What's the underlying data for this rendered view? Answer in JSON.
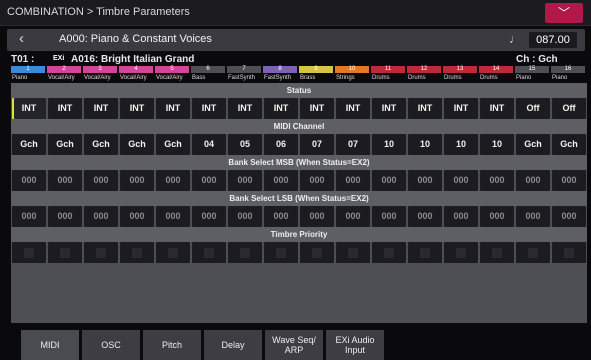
{
  "title": "COMBINATION > Timbre Parameters",
  "menu_icon": "chevron-down-icon",
  "header": {
    "back_icon": "back-chevron-icon",
    "name": "A000: Piano & Constant Voices",
    "tempo_icon": "quarter-note-icon",
    "tempo": "087.00"
  },
  "timbre_info": {
    "timbre": "T01 :",
    "exi": "EXi",
    "program": "A016: Bright Italian Grand",
    "channel": "Ch : Gch"
  },
  "timbres": [
    {
      "num": "1",
      "color": "#3a8ad8",
      "name": "Piano"
    },
    {
      "num": "2",
      "color": "#d3459a",
      "name": "Vocal/Airy"
    },
    {
      "num": "3",
      "color": "#d3459a",
      "name": "Vocal/Airy"
    },
    {
      "num": "4",
      "color": "#d3459a",
      "name": "Vocal/Airy"
    },
    {
      "num": "5",
      "color": "#d3459a",
      "name": "Vocal/Airy"
    },
    {
      "num": "6",
      "color": "#4e4f54",
      "name": "Bass"
    },
    {
      "num": "7",
      "color": "#4e4f54",
      "name": "FastSynth"
    },
    {
      "num": "8",
      "color": "#7d62b0",
      "name": "FastSynth"
    },
    {
      "num": "9",
      "color": "#d8c440",
      "name": "Brass"
    },
    {
      "num": "10",
      "color": "#e07a2a",
      "name": "Strings"
    },
    {
      "num": "11",
      "color": "#c1283a",
      "name": "Drums"
    },
    {
      "num": "12",
      "color": "#c1283a",
      "name": "Drums"
    },
    {
      "num": "13",
      "color": "#c1283a",
      "name": "Drums"
    },
    {
      "num": "14",
      "color": "#c1283a",
      "name": "Drums"
    },
    {
      "num": "15",
      "color": "#4e4f54",
      "name": "Piano"
    },
    {
      "num": "16",
      "color": "#4e4f54",
      "name": "Piano"
    }
  ],
  "sections": {
    "status": "Status",
    "midi_channel": "MIDI Channel",
    "msb": "Bank Select MSB (When Status=EX2)",
    "lsb": "Bank Select LSB (When Status=EX2)",
    "priority": "Timbre Priority"
  },
  "status": [
    "INT",
    "INT",
    "INT",
    "INT",
    "INT",
    "INT",
    "INT",
    "INT",
    "INT",
    "INT",
    "INT",
    "INT",
    "INT",
    "INT",
    "Off",
    "Off"
  ],
  "midi_channel": [
    "Gch",
    "Gch",
    "Gch",
    "Gch",
    "Gch",
    "04",
    "05",
    "06",
    "07",
    "07",
    "10",
    "10",
    "10",
    "10",
    "Gch",
    "Gch"
  ],
  "msb": [
    "000",
    "000",
    "000",
    "000",
    "000",
    "000",
    "000",
    "000",
    "000",
    "000",
    "000",
    "000",
    "000",
    "000",
    "000",
    "000"
  ],
  "lsb": [
    "000",
    "000",
    "000",
    "000",
    "000",
    "000",
    "000",
    "000",
    "000",
    "000",
    "000",
    "000",
    "000",
    "000",
    "000",
    "000"
  ],
  "tabs": [
    {
      "label": "MIDI",
      "active": true
    },
    {
      "label": "OSC"
    },
    {
      "label": "Pitch"
    },
    {
      "label": "Delay"
    },
    {
      "label": "Wave Seq/\nARP"
    },
    {
      "label": "EXi Audio\nInput"
    }
  ]
}
